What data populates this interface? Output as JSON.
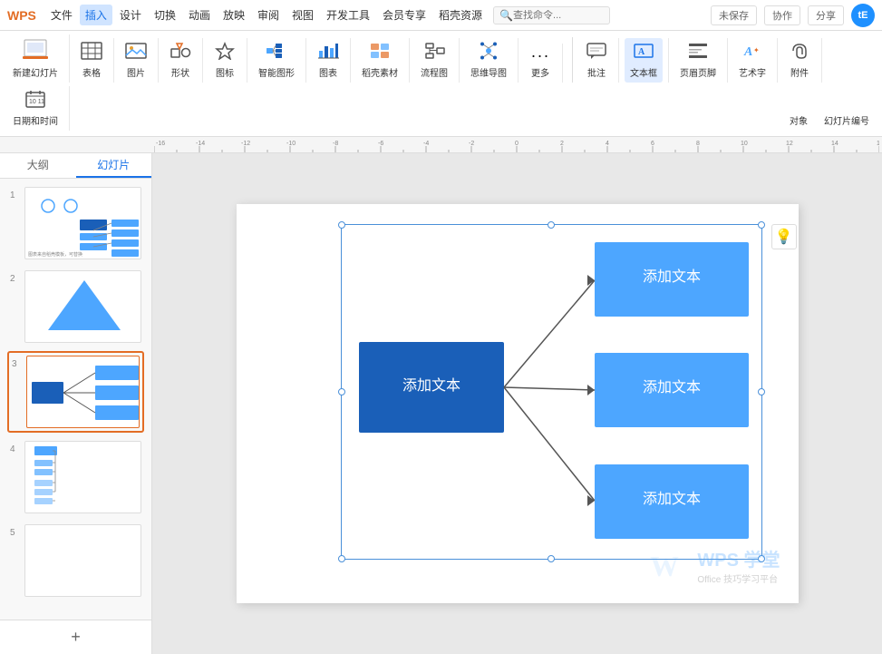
{
  "titlebar": {
    "logo": "WPS",
    "menu_items": [
      "文件",
      "插入",
      "设计",
      "切换",
      "动画",
      "放映",
      "审阅",
      "视图",
      "开发工具",
      "会员专享",
      "稻壳资源"
    ],
    "active_menu": "插入",
    "search_placeholder": "查找命令...",
    "right_actions": [
      "未保存",
      "协作",
      "分享"
    ],
    "user_initials": "tE"
  },
  "ribbon": {
    "groups": [
      {
        "name": "new-slide-group",
        "items": [
          {
            "label": "新建幻灯片",
            "icon": "🖼️",
            "large": true
          }
        ]
      },
      {
        "name": "table-group",
        "items": [
          {
            "label": "表格",
            "icon": "⊞"
          }
        ]
      },
      {
        "name": "image-group",
        "items": [
          {
            "label": "图片",
            "icon": "🖼"
          }
        ]
      },
      {
        "name": "shape-group",
        "items": [
          {
            "label": "形状",
            "icon": "⬡"
          }
        ]
      },
      {
        "name": "icon-group",
        "items": [
          {
            "label": "图标",
            "icon": "★"
          }
        ]
      },
      {
        "name": "smartart-group",
        "items": [
          {
            "label": "智能图形",
            "icon": "🔷"
          }
        ]
      },
      {
        "name": "chart-group",
        "items": [
          {
            "label": "图表",
            "icon": "📊"
          }
        ]
      },
      {
        "name": "material-group",
        "items": [
          {
            "label": "稻壳素材",
            "icon": "🎨"
          }
        ]
      },
      {
        "name": "flow-group",
        "items": [
          {
            "label": "流程图",
            "icon": "⬜"
          }
        ]
      },
      {
        "name": "mindmap-group",
        "items": [
          {
            "label": "思维导图",
            "icon": "🧠"
          }
        ]
      },
      {
        "name": "more-group",
        "items": [
          {
            "label": "更多",
            "icon": "⋯"
          }
        ]
      },
      {
        "name": "comment-group",
        "items": [
          {
            "label": "批注",
            "icon": "💬"
          }
        ]
      },
      {
        "name": "textbox-group",
        "items": [
          {
            "label": "文本框",
            "icon": "A",
            "active": true
          }
        ]
      },
      {
        "name": "header-footer-group",
        "items": [
          {
            "label": "页眉页脚",
            "icon": "☰"
          }
        ]
      },
      {
        "name": "wordart-group",
        "items": [
          {
            "label": "艺术字",
            "icon": "A✦"
          }
        ]
      },
      {
        "name": "attachment-group",
        "items": [
          {
            "label": "附件",
            "icon": "📎"
          }
        ]
      },
      {
        "name": "datetime-group",
        "items": [
          {
            "label": "日期和时间",
            "icon": "📅"
          }
        ]
      }
    ],
    "right_items": [
      "对象",
      "幻灯片编号"
    ]
  },
  "sidebar": {
    "tabs": [
      "大纲",
      "幻灯片"
    ],
    "active_tab": "幻灯片",
    "slides": [
      {
        "num": 1,
        "type": "org-chart"
      },
      {
        "num": 2,
        "type": "triangle"
      },
      {
        "num": 3,
        "type": "flow-diagram",
        "active": true
      },
      {
        "num": 4,
        "type": "hierarchy"
      },
      {
        "num": 5,
        "type": "blank"
      }
    ],
    "add_button": "+"
  },
  "canvas": {
    "diagram": {
      "left_box_text": "添加文本",
      "right_boxes": [
        "添加文本",
        "添加文本",
        "添加文本"
      ]
    }
  },
  "watermark": {
    "logo": "W",
    "name": "WPS 学堂",
    "subtitle": "Office 技巧学习平台"
  }
}
